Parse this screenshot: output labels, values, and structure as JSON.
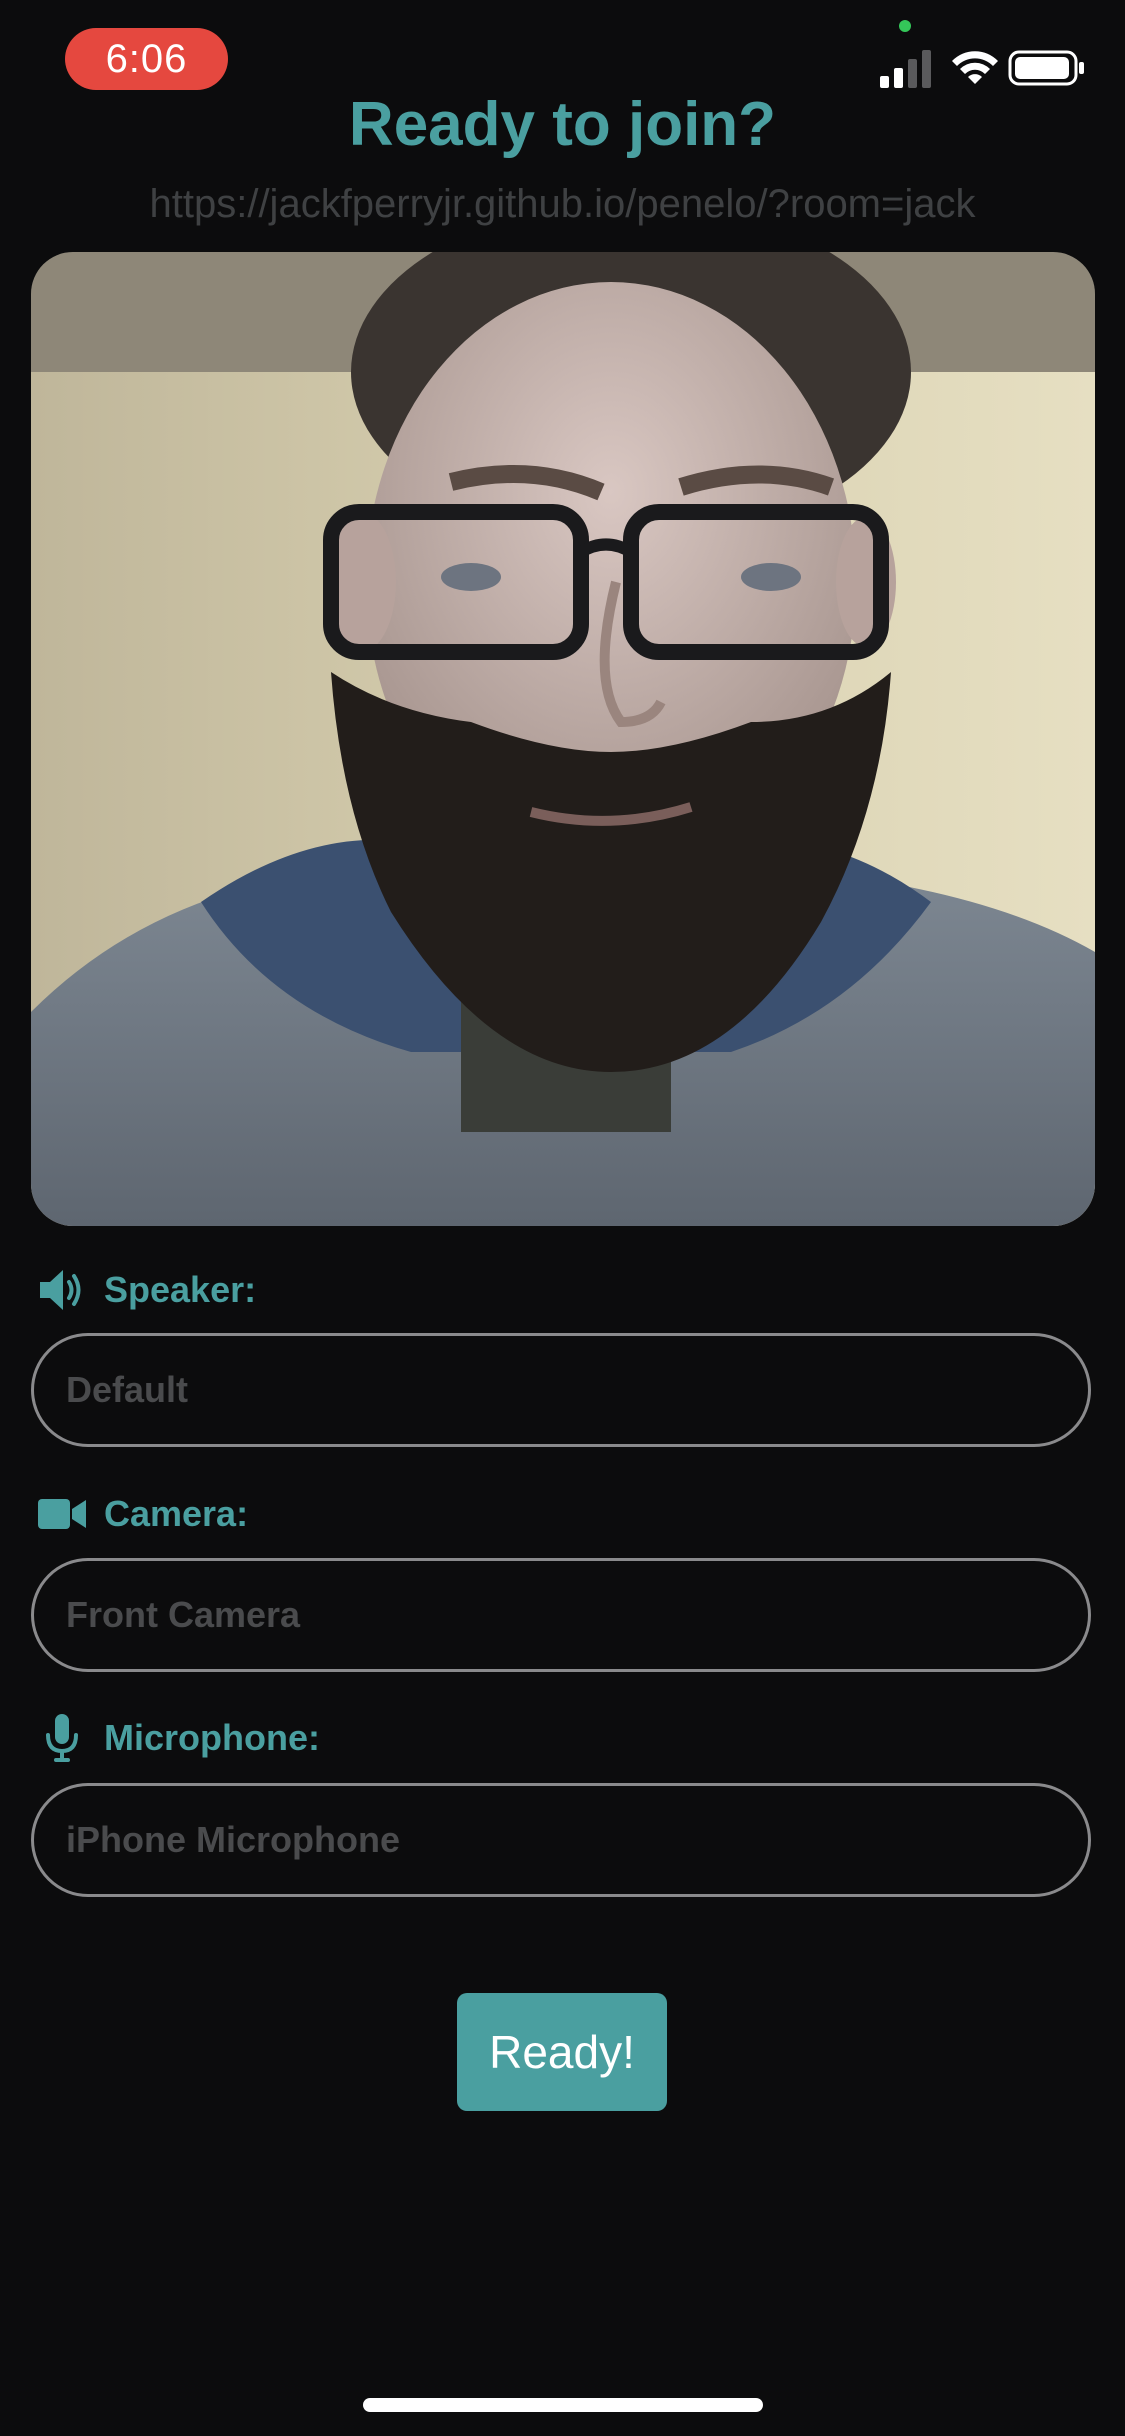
{
  "status_bar": {
    "time": "6:06",
    "time_pill_color": "#e5483f",
    "privacy_dot_color": "#34c759",
    "icons": [
      "cellular-signal-icon",
      "wifi-icon",
      "battery-icon"
    ]
  },
  "header": {
    "title": "Ready to join?",
    "room_url": "https://jackfperryjr.github.io/penelo/?room=jack"
  },
  "preview": {
    "description_icon": "camera-preview"
  },
  "devices": {
    "speaker": {
      "icon": "speaker-icon",
      "label": "Speaker:",
      "value": "Default"
    },
    "camera": {
      "icon": "video-camera-icon",
      "label": "Camera:",
      "value": "Front Camera"
    },
    "microphone": {
      "icon": "microphone-icon",
      "label": "Microphone:",
      "value": "iPhone Microphone"
    }
  },
  "actions": {
    "ready_label": "Ready!"
  },
  "colors": {
    "accent": "#4a9fa0",
    "background": "#0c0c0d",
    "muted_text": "#3f4143",
    "select_border": "#8a8a8c"
  }
}
